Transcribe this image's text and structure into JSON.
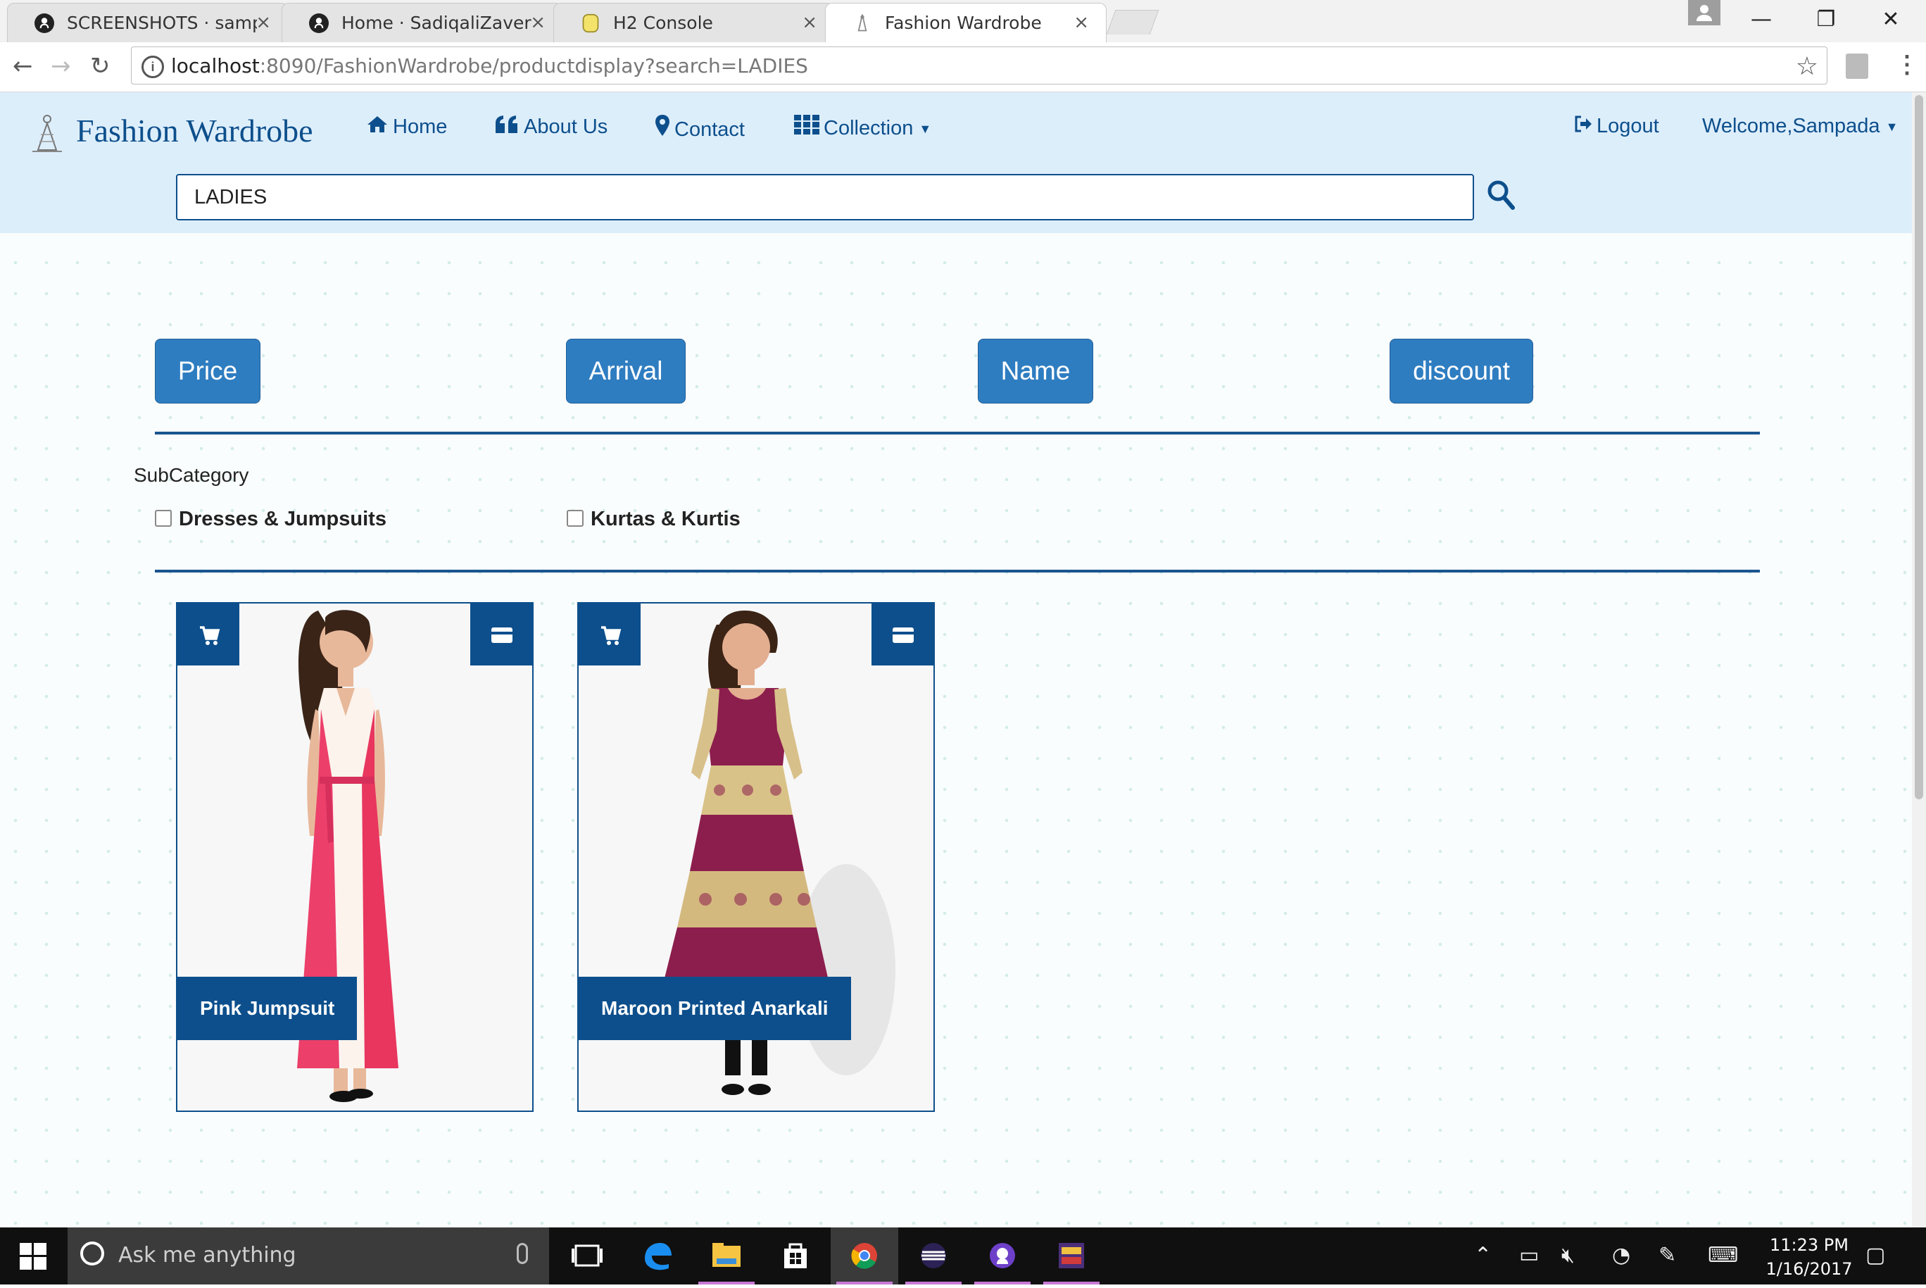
{
  "browser": {
    "tabs": [
      {
        "title": "SCREENSHOTS · sampda/",
        "icon": "github-icon"
      },
      {
        "title": "Home · SadiqaliZaveri/M",
        "icon": "github-icon"
      },
      {
        "title": "H2 Console",
        "icon": "h2-icon"
      },
      {
        "title": "Fashion Wardrobe",
        "icon": "site-logo-icon"
      }
    ],
    "close_glyph": "×",
    "url_host": "localhost",
    "url_rest": ":8090/FashionWardrobe/productdisplay?search=LADIES",
    "window_controls": {
      "minimize": "—",
      "restore": "❐",
      "close": "✕"
    }
  },
  "site": {
    "brand": "Fashion Wardrobe",
    "nav": {
      "home": "Home",
      "about": "About Us",
      "contact": "Contact",
      "collection": "Collection",
      "logout": "Logout",
      "welcome": "Welcome,Sampada"
    },
    "search_value": "LADIES",
    "brand_color": "#0d4f8c",
    "button_color": "#2f7dc1"
  },
  "sort_buttons": {
    "price": "Price",
    "arrival": "Arrival",
    "name": "Name",
    "discount": "discount"
  },
  "subcategory": {
    "label": "SubCategory",
    "options": [
      "Dresses & Jumpsuits",
      "Kurtas & Kurtis"
    ]
  },
  "products": [
    {
      "name": "Pink Jumpsuit"
    },
    {
      "name": "Maroon Printed Anarkali"
    }
  ],
  "taskbar": {
    "search_placeholder": "Ask me anything",
    "time": "11:23 PM",
    "date": "1/16/2017",
    "apps": [
      "task-view-icon",
      "edge-icon",
      "file-explorer-icon",
      "store-icon",
      "chrome-icon",
      "eclipse-icon",
      "github-desktop-icon",
      "java-ee-ide-icon"
    ]
  }
}
